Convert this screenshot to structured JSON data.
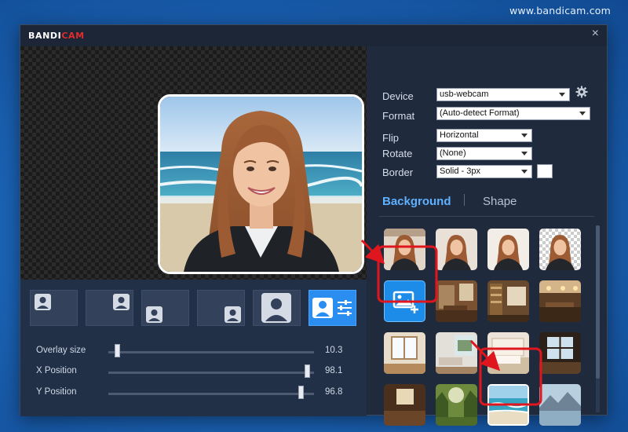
{
  "watermark": "www.bandicam.com",
  "app": {
    "logo_part1": "BANDI",
    "logo_part2": "CAM",
    "close_glyph": "×"
  },
  "colors": {
    "accent": "#2a8df0",
    "tab_active": "#5fb1ff",
    "logo_red": "#e32b2b",
    "highlight_red": "#e0161e"
  },
  "settings": {
    "device_label": "Device",
    "device_value": "usb-webcam",
    "format_label": "Format",
    "format_value": "(Auto-detect Format)",
    "flip_label": "Flip",
    "flip_value": "Horizontal",
    "rotate_label": "Rotate",
    "rotate_value": "(None)",
    "border_label": "Border",
    "border_value": "Solid - 3px",
    "border_color": "#ffffff"
  },
  "tabs": {
    "background": "Background",
    "shape": "Shape",
    "active": "Background"
  },
  "overlay": {
    "shape_buttons": [
      {
        "name": "position-top-left",
        "active": false
      },
      {
        "name": "position-top-right",
        "active": false
      },
      {
        "name": "position-bottom-left",
        "active": false
      },
      {
        "name": "position-bottom-right",
        "active": false
      },
      {
        "name": "full-size",
        "active": false
      },
      {
        "name": "custom-settings",
        "active": true
      }
    ]
  },
  "sliders": [
    {
      "label": "Overlay size",
      "value": "10.3",
      "level": 0.03
    },
    {
      "label": "X Position",
      "value": "98.1",
      "level": 0.98
    },
    {
      "label": "Y Position",
      "value": "96.8",
      "level": 0.95
    }
  ],
  "backgrounds": [
    {
      "name": "bg-person-room-1"
    },
    {
      "name": "bg-person-blur"
    },
    {
      "name": "bg-person-bright"
    },
    {
      "name": "bg-person-transparent"
    },
    {
      "name": "bg-add-image",
      "highlighted": true
    },
    {
      "name": "bg-study-room"
    },
    {
      "name": "bg-bookshelf-room"
    },
    {
      "name": "bg-cafe"
    },
    {
      "name": "bg-window-room"
    },
    {
      "name": "bg-living-room"
    },
    {
      "name": "bg-bedroom"
    },
    {
      "name": "bg-library-hall"
    },
    {
      "name": "bg-wood-room"
    },
    {
      "name": "bg-forest"
    },
    {
      "name": "bg-beach",
      "selected": true
    },
    {
      "name": "bg-mountain-lake"
    }
  ]
}
